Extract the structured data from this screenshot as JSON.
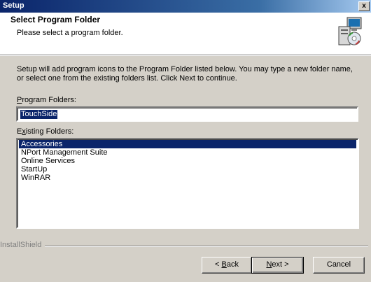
{
  "window": {
    "title": "Setup",
    "close_label": "x"
  },
  "header": {
    "title": "Select Program Folder",
    "subtitle": "Please select a program folder.",
    "icon": "setup-computer-icon"
  },
  "body": {
    "description": "Setup will add program icons to the Program Folder listed below.  You may type a new folder name, or select one from the existing folders list.  Click Next to continue.",
    "program_folders": {
      "label_underline": "P",
      "label_rest": "rogram Folders:",
      "value": "TouchSide"
    },
    "existing_folders": {
      "label_first": "E",
      "label_underline": "x",
      "label_rest": "isting Folders:",
      "items": [
        "Accessories",
        "NPort Management Suite",
        "Online Services",
        "StartUp",
        "WinRAR"
      ],
      "selected": "Accessories"
    }
  },
  "footer": {
    "brand": "InstallShield",
    "back": {
      "prefix": "< ",
      "underline": "B",
      "rest": "ack"
    },
    "next": {
      "underline": "N",
      "rest": "ext >"
    },
    "cancel": "Cancel"
  },
  "colors": {
    "selection": "#0a246a",
    "face": "#d4d0c8",
    "title_start": "#0a246a"
  }
}
